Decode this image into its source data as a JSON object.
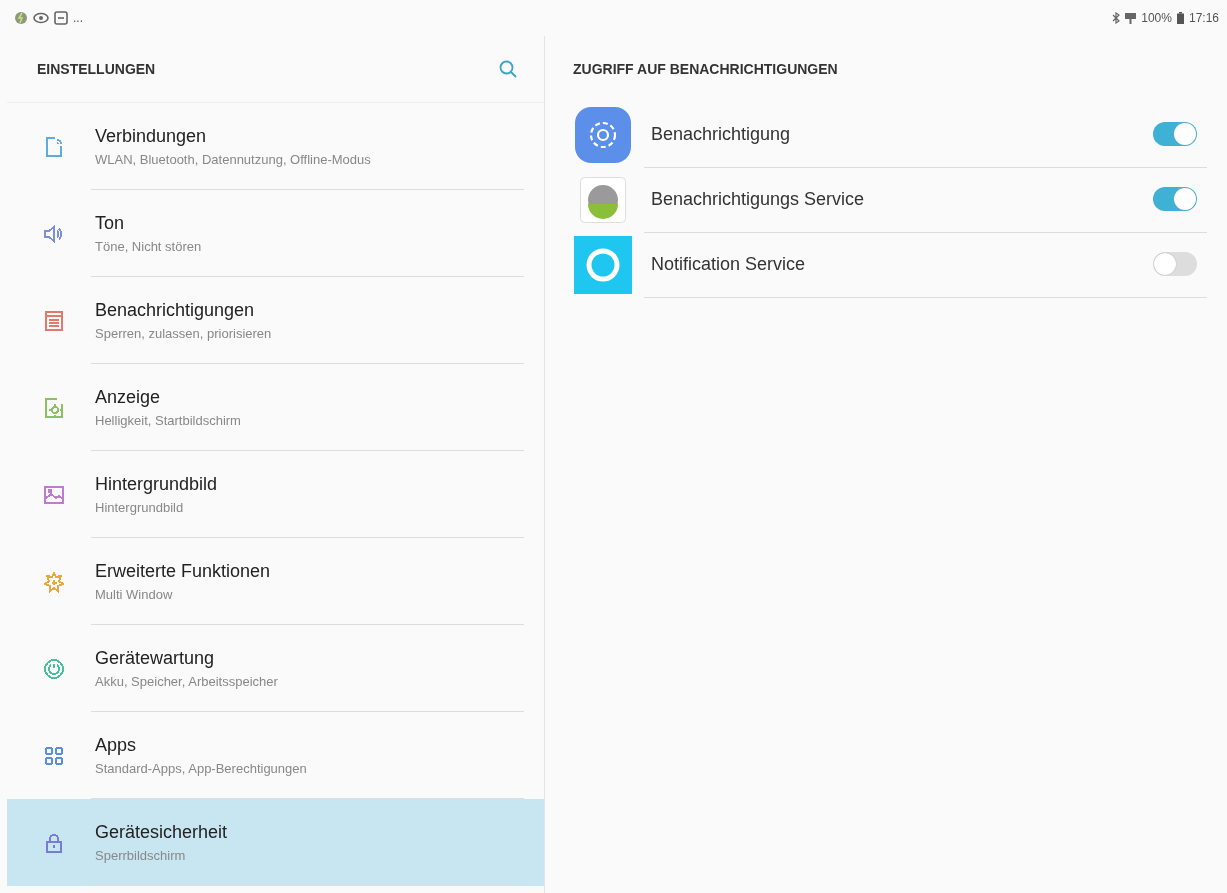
{
  "status_bar": {
    "more": "...",
    "battery": "100%",
    "time": "17:16"
  },
  "sidebar": {
    "title": "EINSTELLUNGEN",
    "items": [
      {
        "label": "Verbindungen",
        "subtitle": "WLAN, Bluetooth, Datennutzung, Offline-Modus",
        "color": "#5aaee0",
        "selected": false
      },
      {
        "label": "Ton",
        "subtitle": "Töne, Nicht stören",
        "color": "#7a8fe0",
        "selected": false
      },
      {
        "label": "Benachrichtigungen",
        "subtitle": "Sperren, zulassen, priorisieren",
        "color": "#e07a6e",
        "selected": false
      },
      {
        "label": "Anzeige",
        "subtitle": "Helligkeit, Startbildschirm",
        "color": "#8cc063",
        "selected": false
      },
      {
        "label": "Hintergrundbild",
        "subtitle": "Hintergrundbild",
        "color": "#c07ad0",
        "selected": false
      },
      {
        "label": "Erweiterte Funktionen",
        "subtitle": "Multi Window",
        "color": "#e8a93a",
        "selected": false
      },
      {
        "label": "Gerätewartung",
        "subtitle": "Akku, Speicher, Arbeitsspeicher",
        "color": "#4cbf9a",
        "selected": false
      },
      {
        "label": "Apps",
        "subtitle": "Standard-Apps, App-Berechtigungen",
        "color": "#5a8ee0",
        "selected": false
      },
      {
        "label": "Gerätesicherheit",
        "subtitle": "Sperrbildschirm",
        "color": "#7a7ad8",
        "selected": true
      }
    ]
  },
  "content": {
    "title": "ZUGRIFF AUF BENACHRICHTIGUNGEN",
    "apps": [
      {
        "name": "Benachrichtigung",
        "on": true
      },
      {
        "name": "Benachrichtigungs Service",
        "on": true
      },
      {
        "name": "Notification Service",
        "on": false
      }
    ]
  }
}
